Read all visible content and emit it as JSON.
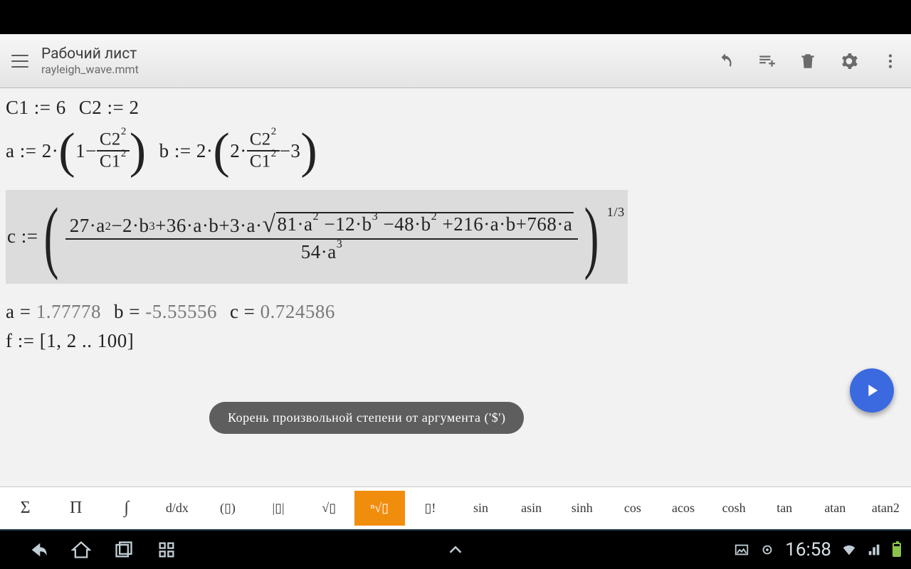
{
  "header": {
    "title": "Рабочий лист",
    "subtitle": "rayleigh_wave.mmt"
  },
  "worksheet": {
    "line1": {
      "c1_assign": "C1 := 6",
      "c2_assign": "C2 := 2"
    },
    "line2": {
      "a_prefix": "a := 2·",
      "a_inner_pre": "1−",
      "a_frac_num": "C2",
      "a_frac_num_pow": "2",
      "a_frac_den": "C1",
      "a_frac_den_pow": "2",
      "b_prefix": "b := 2·",
      "b_inner_pre": "2·",
      "b_frac_num": "C2",
      "b_frac_num_pow": "2",
      "b_frac_den": "C1",
      "b_frac_den_pow": "2",
      "b_inner_post": "−3"
    },
    "line3": {
      "c_prefix": "c :=",
      "num_pre": "27·a",
      "p2": "2",
      "t2": "−2·b",
      "p3": "3",
      "t3": "+36·a·b+3·a·",
      "sqrt_body_1": "81·a",
      "sq_p2a": "2",
      "sqrt_body_2": "−12·b",
      "sq_p3a": "3",
      "sqrt_body_3": "−48·b",
      "sq_p2b": "2",
      "sqrt_body_4": "+216·a·b+768·a",
      "den_pre": "54·a",
      "den_pow": "3",
      "outer_pow": "1/3"
    },
    "results": {
      "a_lbl": "a = ",
      "a_val": "1.77778",
      "b_lbl": "b = ",
      "b_val": "-5.55556",
      "c_lbl": "c = ",
      "c_val": "0.724586"
    },
    "line_f": "f := [1, 2 .. 100]"
  },
  "tooltip": "Корень произвольной степени от аргумента ('$')",
  "symbol_bar": [
    {
      "label": "Σ",
      "name": "sum",
      "big": true
    },
    {
      "label": "Π",
      "name": "product",
      "big": true
    },
    {
      "label": "∫",
      "name": "integral",
      "big": true
    },
    {
      "label": "d/dx",
      "name": "derivative"
    },
    {
      "label": "(▯)",
      "name": "parentheses"
    },
    {
      "label": "|▯|",
      "name": "absolute"
    },
    {
      "label": "√▯",
      "name": "sqrt"
    },
    {
      "label": "ⁿ√▯",
      "name": "nth-root",
      "active": true
    },
    {
      "label": "▯!",
      "name": "factorial"
    },
    {
      "label": "sin",
      "name": "sin"
    },
    {
      "label": "asin",
      "name": "asin"
    },
    {
      "label": "sinh",
      "name": "sinh"
    },
    {
      "label": "cos",
      "name": "cos"
    },
    {
      "label": "acos",
      "name": "acos"
    },
    {
      "label": "cosh",
      "name": "cosh"
    },
    {
      "label": "tan",
      "name": "tan"
    },
    {
      "label": "atan",
      "name": "atan"
    },
    {
      "label": "atan2",
      "name": "atan2"
    }
  ],
  "navbar": {
    "clock": "16:58"
  }
}
